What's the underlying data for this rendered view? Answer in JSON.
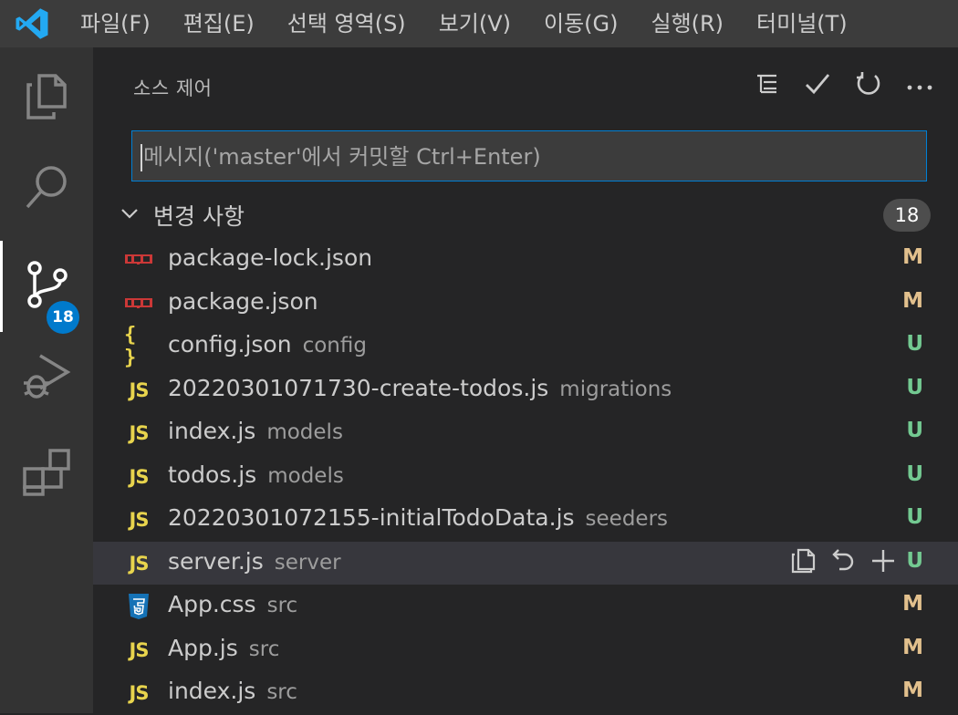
{
  "menu": {
    "items": [
      "파일(F)",
      "편집(E)",
      "선택 영역(S)",
      "보기(V)",
      "이동(G)",
      "실행(R)",
      "터미널(T)"
    ]
  },
  "activity_bar": {
    "items": [
      {
        "name": "explorer",
        "icon": "files-icon"
      },
      {
        "name": "search",
        "icon": "search-icon"
      },
      {
        "name": "source-control",
        "icon": "source-control-icon",
        "badge": "18",
        "active": true
      },
      {
        "name": "run-debug",
        "icon": "debug-icon"
      },
      {
        "name": "extensions",
        "icon": "extensions-icon"
      }
    ]
  },
  "scm": {
    "title": "소스 제어",
    "commit_placeholder": "메시지('master'에서 커밋할 Ctrl+Enter)",
    "changes_label": "변경 사항",
    "changes_count": "18",
    "files": [
      {
        "name": "package-lock.json",
        "dir": "",
        "status": "M",
        "icon": "npm"
      },
      {
        "name": "package.json",
        "dir": "",
        "status": "M",
        "icon": "npm"
      },
      {
        "name": "config.json",
        "dir": "config",
        "status": "U",
        "icon": "json"
      },
      {
        "name": "20220301071730-create-todos.js",
        "dir": "migrations",
        "status": "U",
        "icon": "js"
      },
      {
        "name": "index.js",
        "dir": "models",
        "status": "U",
        "icon": "js"
      },
      {
        "name": "todos.js",
        "dir": "models",
        "status": "U",
        "icon": "js"
      },
      {
        "name": "20220301072155-initialTodoData.js",
        "dir": "seeders",
        "status": "U",
        "icon": "js"
      },
      {
        "name": "server.js",
        "dir": "server",
        "status": "U",
        "icon": "js",
        "hover": true
      },
      {
        "name": "App.css",
        "dir": "src",
        "status": "M",
        "icon": "css"
      },
      {
        "name": "App.js",
        "dir": "src",
        "status": "M",
        "icon": "js"
      },
      {
        "name": "index.js",
        "dir": "src",
        "status": "M",
        "icon": "js"
      }
    ]
  },
  "icon_labels": {
    "js": "JS",
    "json": "{ }"
  },
  "colors": {
    "accent": "#007acc",
    "modified": "#e2c08d",
    "untracked": "#73c991",
    "js": "#e8d44d",
    "npm": "#cb3837",
    "css": "#1572b6"
  }
}
